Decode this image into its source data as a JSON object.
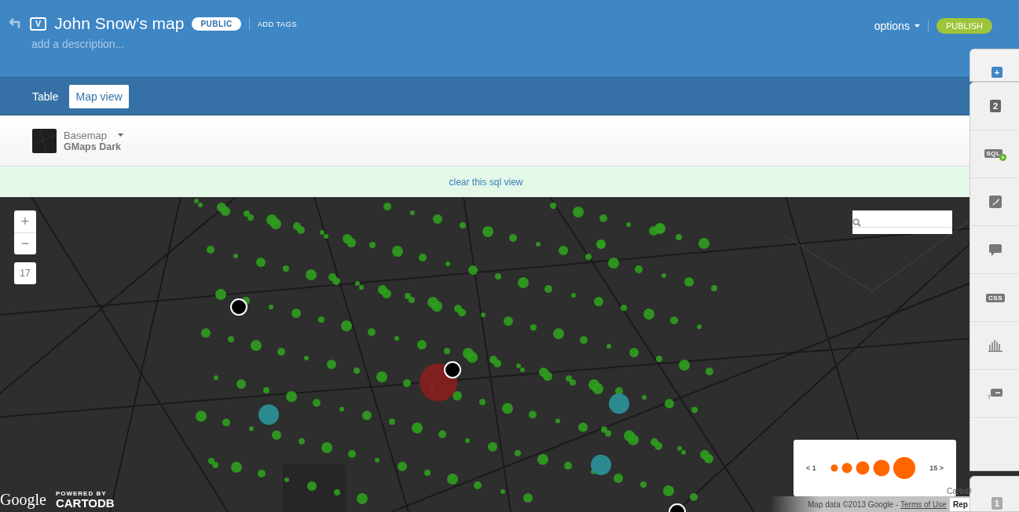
{
  "header": {
    "badge": "V",
    "title": "John Snow's map",
    "visibility": "PUBLIC",
    "add_tags": "ADD TAGS",
    "description_placeholder": "add a description...",
    "options": "options",
    "publish": "PUBLISH"
  },
  "tabs": [
    {
      "label": "Table",
      "selected": false
    },
    {
      "label": "Map view",
      "selected": true
    }
  ],
  "basemap": {
    "label": "Basemap",
    "value": "GMaps Dark"
  },
  "sql_notice": {
    "link": "clear this sql view"
  },
  "map": {
    "kind": "picture",
    "zoom_in": "+",
    "zoom_out": "−",
    "zoom_level": "17",
    "legend": {
      "min_label": "< 1",
      "max_label": "15 >"
    },
    "logos": {
      "google": "Google",
      "powered_by": "POWERED BY",
      "cartodb": "CARTODB"
    },
    "attribution": {
      "cartodb": "CartoD",
      "map_data": "Map data ©2013 Google - ",
      "terms": "Terms of Use",
      "report": "Rep"
    }
  },
  "sidebar": {
    "top": {
      "kind": "add",
      "label": "+"
    },
    "items": [
      {
        "kind": "count",
        "label": "2"
      },
      {
        "kind": "sql",
        "label": "SQL"
      },
      {
        "kind": "wizard"
      },
      {
        "kind": "infowindow"
      },
      {
        "kind": "css",
        "label": "CSS"
      },
      {
        "kind": "chart"
      },
      {
        "kind": "legend"
      }
    ],
    "bottom": {
      "kind": "count",
      "label": "1"
    }
  }
}
